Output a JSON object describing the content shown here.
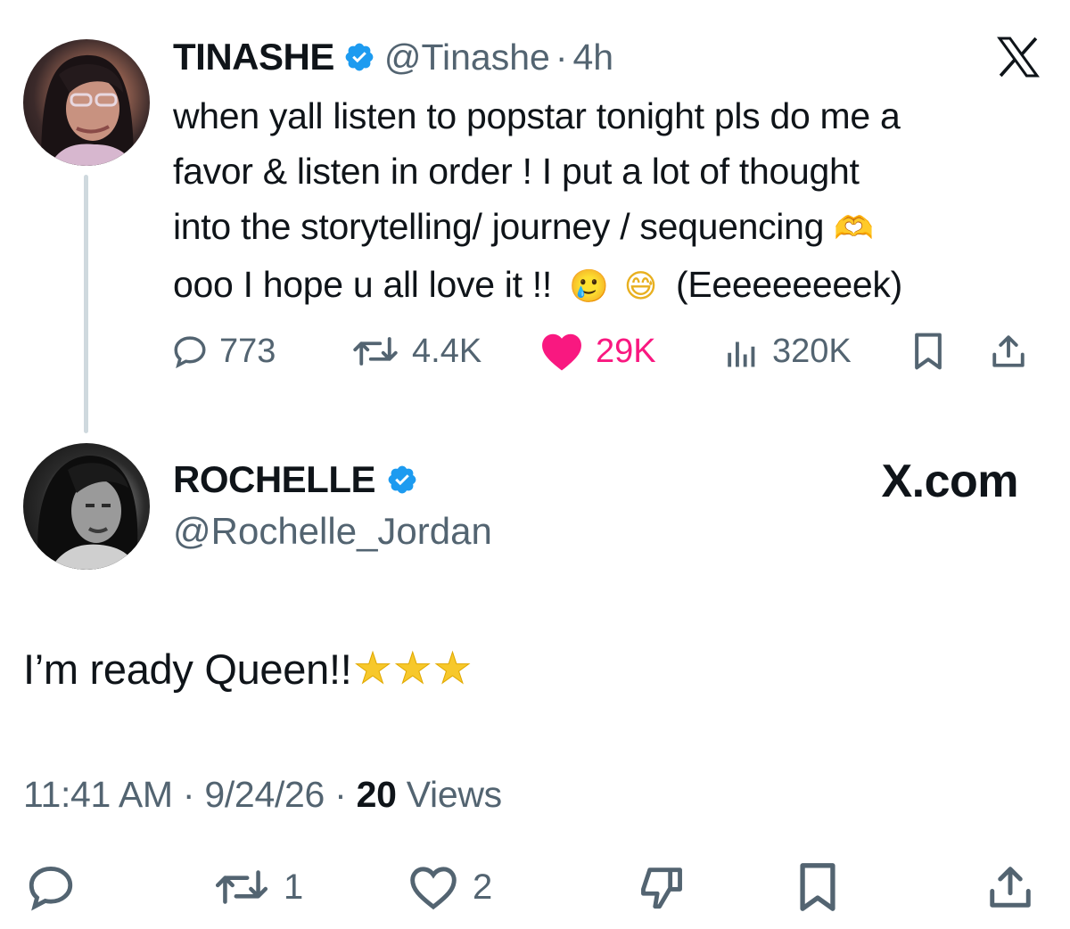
{
  "colors": {
    "verified_blue": "#1d9bf0",
    "like_pink": "#f91880",
    "text_gray": "#536471",
    "thread_line": "#cfd9de"
  },
  "original_tweet": {
    "author": {
      "name": "TINASHE",
      "handle": "@Tinashe",
      "verified": true
    },
    "separator": "·",
    "time_ago": "4h",
    "text_lines": [
      "when yall listen to popstar tonight pls do me a",
      "favor & listen in order ! I put a lot of thought",
      "into the storytelling/ journey / sequencing",
      "ooo I hope u all love it !!"
    ],
    "emoji_line3": "🫶",
    "emoji_line4": [
      "🥲",
      "😅"
    ],
    "tail_text": "(Eeeeeeeeek)",
    "stats": {
      "replies": "773",
      "reposts": "4.4K",
      "likes": "29K",
      "views": "320K"
    },
    "icons": [
      "reply-icon",
      "repost-icon",
      "like-icon",
      "views-icon",
      "bookmark-icon",
      "share-icon"
    ]
  },
  "x_logo": "𝕏",
  "reply_tweet": {
    "author": {
      "name": "ROCHELLE",
      "handle": "@Rochelle_Jordan",
      "verified": true
    },
    "site_label": "X.com",
    "text": "I’m ready Queen!!",
    "stars": [
      "⭐",
      "⭐",
      "⭐"
    ],
    "timestamp": {
      "time": "11:41 AM",
      "sep1": " · ",
      "date": "9/24/26",
      "sep2": " · ",
      "views_count": "20",
      "views_label": " Views"
    },
    "stats": {
      "reposts": "1",
      "likes": "2"
    },
    "icons": [
      "reply-icon",
      "repost-icon",
      "like-icon",
      "dislike-icon",
      "bookmark-icon",
      "share-icon"
    ]
  }
}
